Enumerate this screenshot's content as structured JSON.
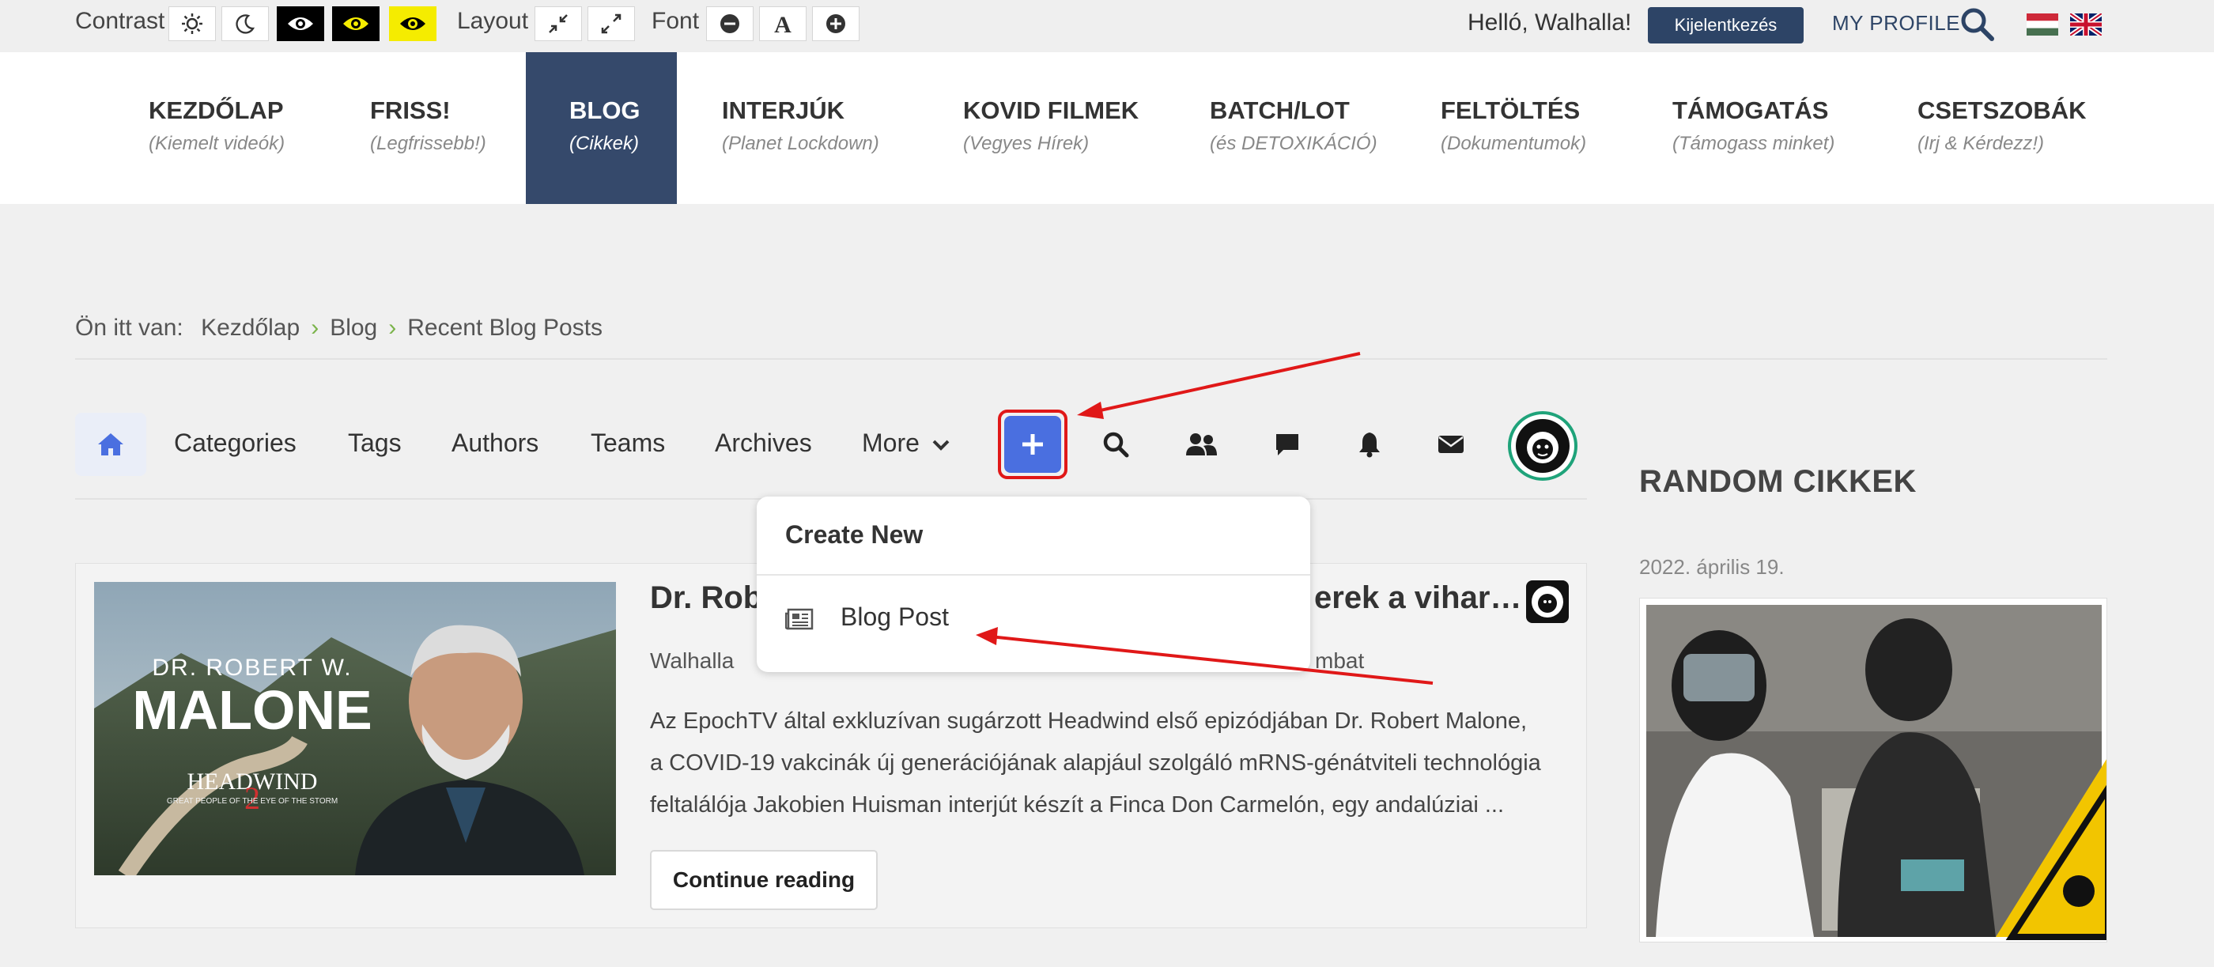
{
  "topbar": {
    "contrast_label": "Contrast",
    "layout_label": "Layout",
    "font_label": "Font",
    "greeting": "Helló, Walhalla!",
    "logout_label": "Kijelentkezés",
    "my_profile_label": "MY PROFILE"
  },
  "nav": {
    "items": [
      {
        "title": "KEZDŐLAP",
        "subtitle": "(Kiemelt videók)"
      },
      {
        "title": "FRISS!",
        "subtitle": "(Legfrissebb!)"
      },
      {
        "title": "BLOG",
        "subtitle": "(Cikkek)"
      },
      {
        "title": "INTERJÚK",
        "subtitle": "(Planet Lockdown)"
      },
      {
        "title": "KOVID FILMEK",
        "subtitle": "(Vegyes Hírek)"
      },
      {
        "title": "BATCH/LOT",
        "subtitle": "(és DETOXIKÁCIÓ)"
      },
      {
        "title": "FELTÖLTÉS",
        "subtitle": "(Dokumentumok)"
      },
      {
        "title": "TÁMOGATÁS",
        "subtitle": "(Támogass minket)"
      },
      {
        "title": "CSETSZOBÁK",
        "subtitle": "(Irj & Kérdezz!)"
      }
    ]
  },
  "breadcrumb": {
    "prefix": "Ön itt van:",
    "items": [
      "Kezdőlap",
      "Blog",
      "Recent Blog Posts"
    ]
  },
  "blog_toolbar": {
    "links": [
      "Categories",
      "Tags",
      "Authors",
      "Teams",
      "Archives",
      "More"
    ]
  },
  "dropdown": {
    "header": "Create New",
    "item_label": "Blog Post"
  },
  "post": {
    "title_left": "Dr. Rob",
    "title_right": "erek a vihar…",
    "author": "Walhalla",
    "meta_right": "mbat",
    "excerpt": "Az EpochTV által exkluzívan sugárzott Headwind első epizódjában Dr. Robert Malone, a COVID-19 vakcinák új generációjának alapjául szolgáló mRNS-génátviteli technológia feltalálója Jakobien Huisman interjút készít a Finca Don Carmelón, egy andalúziai ...",
    "continue_label": "Continue reading",
    "thumb_name_top": "DR. ROBERT W.",
    "thumb_name": "MALONE",
    "thumb_show": "HEADWIND",
    "thumb_episode": "2",
    "thumb_tagline": "GREAT PEOPLE OF THE EYE OF THE STORM"
  },
  "sidebar": {
    "title": "RANDOM CIKKEK",
    "date": "2022. április 19."
  },
  "colors": {
    "nav_active": "#35496b",
    "accent_blue": "#4a6fe0",
    "highlight_red": "#e01818",
    "breadcrumb_sep": "#7ab34a"
  }
}
